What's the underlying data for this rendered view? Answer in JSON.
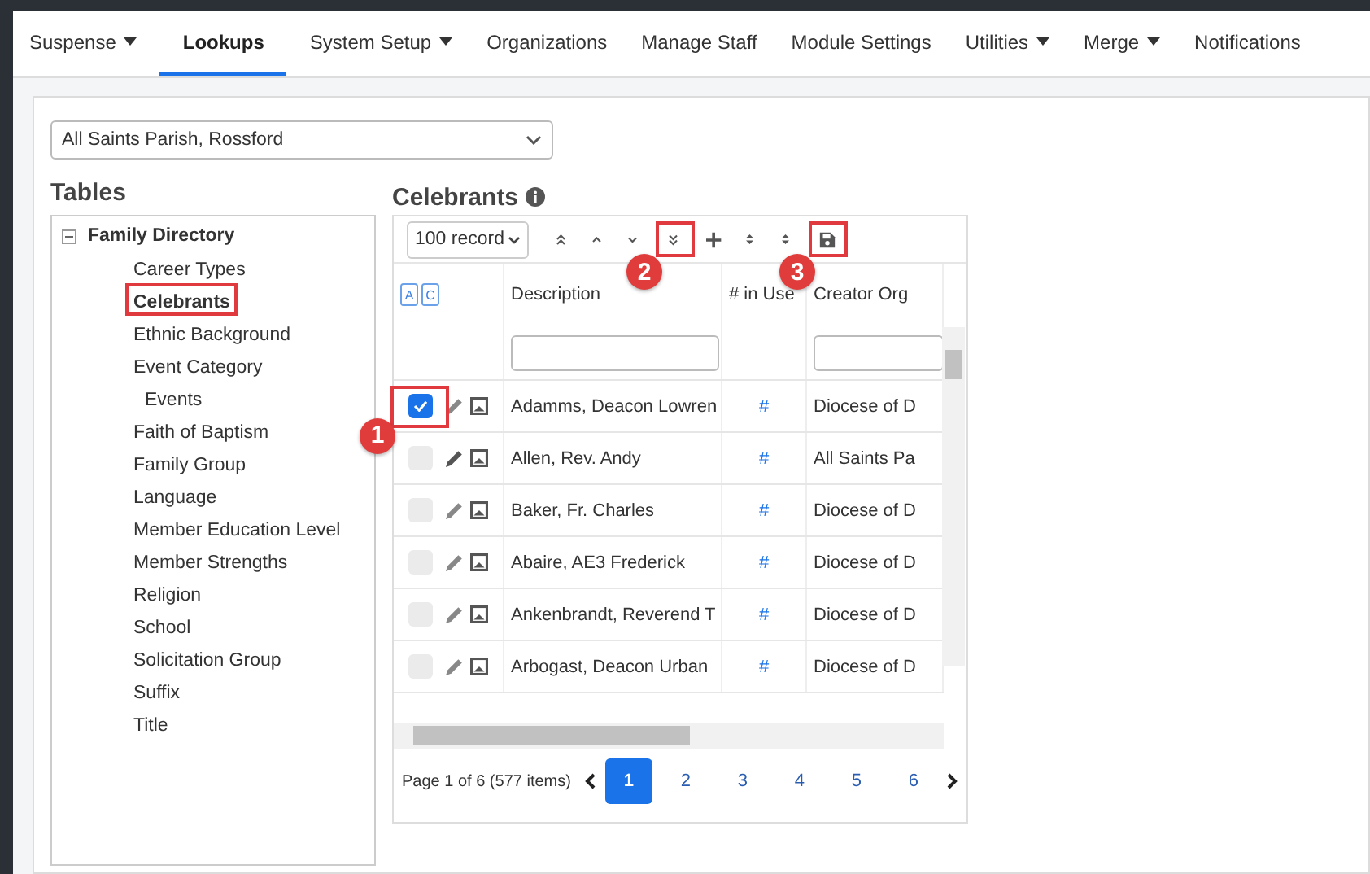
{
  "nav": [
    {
      "label": "Suspense",
      "has_menu": true,
      "selected": false
    },
    {
      "label": "Lookups",
      "has_menu": false,
      "selected": true
    },
    {
      "label": "System Setup",
      "has_menu": true,
      "selected": false
    },
    {
      "label": "Organizations",
      "has_menu": false,
      "selected": false
    },
    {
      "label": "Manage Staff",
      "has_menu": false,
      "selected": false
    },
    {
      "label": "Module Settings",
      "has_menu": false,
      "selected": false
    },
    {
      "label": "Utilities",
      "has_menu": true,
      "selected": false
    },
    {
      "label": "Merge",
      "has_menu": true,
      "selected": false
    },
    {
      "label": "Notifications",
      "has_menu": false,
      "selected": false
    }
  ],
  "organization_select": {
    "value": "All Saints Parish, Rossford"
  },
  "tables": {
    "title": "Tables",
    "tree": [
      {
        "label": "Family Directory",
        "expanded": true,
        "children": [
          {
            "label": "Career Types",
            "selected": false,
            "highlighted": false
          },
          {
            "label": "Celebrants",
            "selected": true,
            "highlighted": true
          },
          {
            "label": "Ethnic Background",
            "selected": false,
            "highlighted": false
          },
          {
            "label": "Event Category",
            "selected": false,
            "highlighted": false,
            "children": [
              {
                "label": "Events",
                "selected": false,
                "highlighted": false
              }
            ]
          },
          {
            "label": "Faith of Baptism",
            "selected": false,
            "highlighted": false
          },
          {
            "label": "Family Group",
            "selected": false,
            "highlighted": false
          },
          {
            "label": "Language",
            "selected": false,
            "highlighted": false
          },
          {
            "label": "Member Education Level",
            "selected": false,
            "highlighted": false
          },
          {
            "label": "Member Strengths",
            "selected": false,
            "highlighted": false
          },
          {
            "label": "Religion",
            "selected": false,
            "highlighted": false
          },
          {
            "label": "School",
            "selected": false,
            "highlighted": false
          },
          {
            "label": "Solicitation Group",
            "selected": false,
            "highlighted": false
          },
          {
            "label": "Suffix",
            "selected": false,
            "highlighted": false
          },
          {
            "label": "Title",
            "selected": false,
            "highlighted": false
          }
        ]
      }
    ]
  },
  "grid": {
    "title": "Celebrants",
    "page_size": "100 record",
    "toolbar": [
      {
        "kind": "collapse-all",
        "highlighted": false
      },
      {
        "kind": "up",
        "highlighted": false
      },
      {
        "kind": "down",
        "highlighted": false
      },
      {
        "kind": "expand-all",
        "highlighted": true,
        "callout": "2"
      },
      {
        "kind": "add",
        "highlighted": false
      },
      {
        "kind": "sort",
        "highlighted": false
      },
      {
        "kind": "sort",
        "highlighted": false
      },
      {
        "kind": "save",
        "highlighted": true,
        "callout": "3"
      }
    ],
    "header_toggles": [
      "A",
      "C"
    ],
    "columns": [
      "Description",
      "# in Use",
      "Creator Org"
    ],
    "rows": [
      {
        "checked": true,
        "highlighted": true,
        "callout": "1",
        "description": "Adamms, Deacon Lowren",
        "in_use": "#",
        "creator": "Diocese of D"
      },
      {
        "checked": false,
        "highlighted": false,
        "description": "Allen, Rev. Andy",
        "in_use": "#",
        "creator": "All Saints Pa"
      },
      {
        "checked": false,
        "highlighted": false,
        "description": "Baker, Fr. Charles",
        "in_use": "#",
        "creator": "Diocese of D"
      },
      {
        "checked": false,
        "highlighted": false,
        "description": "Abaire, AE3 Frederick",
        "in_use": "#",
        "creator": "Diocese of D"
      },
      {
        "checked": false,
        "highlighted": false,
        "description": "Ankenbrandt, Reverend T",
        "in_use": "#",
        "creator": "Diocese of D"
      },
      {
        "checked": false,
        "highlighted": false,
        "description": "Arbogast, Deacon Urban",
        "in_use": "#",
        "creator": "Diocese of D"
      }
    ],
    "pager": {
      "summary": "Page 1 of 6 (577 items)",
      "pages": [
        {
          "label": "1",
          "selected": true
        },
        {
          "label": "2",
          "selected": false
        },
        {
          "label": "3",
          "selected": false
        },
        {
          "label": "4",
          "selected": false
        },
        {
          "label": "5",
          "selected": false
        },
        {
          "label": "6",
          "selected": false
        }
      ]
    }
  }
}
